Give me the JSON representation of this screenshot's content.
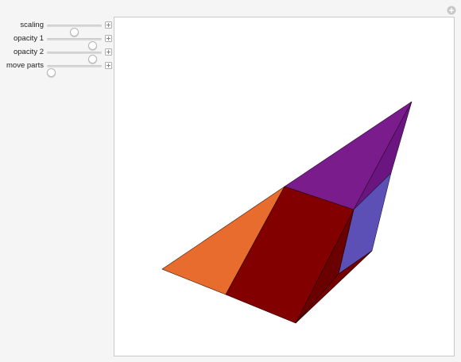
{
  "controls": [
    {
      "label": "scaling",
      "value": 0.5
    },
    {
      "label": "opacity 1",
      "value": 0.9
    },
    {
      "label": "opacity 2",
      "value": 0.9
    },
    {
      "label": "move parts",
      "value": 0.0
    }
  ],
  "icons": {
    "panel_plus": "plus-circle-icon",
    "control_plus": "plus-square-icon"
  },
  "colors": {
    "orange_face": "#e86c2e",
    "dark_red_face": "#830000",
    "deep_red_face": "#6a0000",
    "purple_top": "#7b1c8c",
    "purple_side": "#6a1580",
    "blue_face": "#5c4fb5"
  }
}
